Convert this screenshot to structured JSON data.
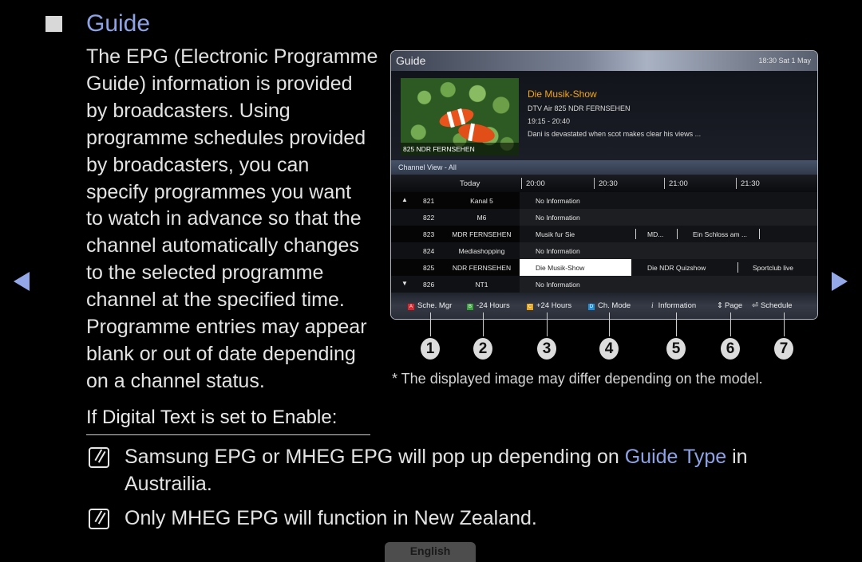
{
  "heading": {
    "title": "Guide"
  },
  "body_lines": [
    "The EPG (Electronic Programme",
    "Guide) information is provided",
    "by broadcasters. Using",
    "programme schedules provided",
    "by broadcasters, you can",
    "specify programmes you want",
    "to watch in advance so that the",
    "channel automatically changes",
    "to the selected programme",
    "channel at the specified time.",
    "Programme entries may appear",
    "blank or out of date depending",
    "on a channel status."
  ],
  "guide_panel": {
    "title": "Guide",
    "datetime": "18:30 Sat 1 May",
    "preview": {
      "thumb_caption": "825 NDR FERNSEHEN",
      "program_title": "Die Musik-Show",
      "channel_line": "DTV Air 825 NDR FERNSEHEN",
      "time_range": "19:15 - 20:40",
      "description": "Dani is devastated when scot makes clear his views ..."
    },
    "channel_view": "Channel View - All",
    "timeline": {
      "day": "Today",
      "times": [
        "20:00",
        "20:30",
        "21:00",
        "21:30"
      ]
    },
    "rows": [
      {
        "arrow": "▲",
        "num": "821",
        "name": "Kanal 5",
        "programs": [
          "No Information"
        ]
      },
      {
        "arrow": "",
        "num": "822",
        "name": "M6",
        "programs": [
          "No Information"
        ]
      },
      {
        "arrow": "",
        "num": "823",
        "name": "MDR FERNSEHEN",
        "programs": [
          "Musik fur Sie",
          "MD...",
          "Ein Schloss am ..."
        ]
      },
      {
        "arrow": "",
        "num": "824",
        "name": "Mediashopping",
        "programs": [
          "No Information"
        ]
      },
      {
        "arrow": "",
        "num": "825",
        "name": "NDR FERNSEHEN",
        "programs": [
          "Die Musik-Show",
          "Die NDR Quizshow",
          "Sportclub live"
        ]
      },
      {
        "arrow": "▼",
        "num": "826",
        "name": "NT1",
        "programs": [
          "No Information"
        ]
      }
    ],
    "footer": [
      {
        "key": "A",
        "color": "#e0262b",
        "label": "Sche. Mgr"
      },
      {
        "key": "B",
        "color": "#3aa23a",
        "label": "-24 Hours"
      },
      {
        "key": "C",
        "color": "#e8a820",
        "label": "+24 Hours"
      },
      {
        "key": "D",
        "color": "#1e8fd8",
        "label": "Ch. Mode"
      },
      {
        "icon": "info-icon",
        "glyph": "i",
        "label": "Information"
      },
      {
        "icon": "page-updown-icon",
        "glyph": "⇕",
        "label": "Page"
      },
      {
        "icon": "enter-icon",
        "glyph": "⏎",
        "label": "Schedule"
      }
    ]
  },
  "callouts": [
    "1",
    "2",
    "3",
    "4",
    "5",
    "6",
    "7"
  ],
  "disclaimer": "* The displayed image may differ depending on the model.",
  "subheading": "If Digital Text is set to Enable:",
  "notes": [
    {
      "before": "Samsung EPG or MHEG EPG will pop up depending on ",
      "highlight": "Guide Type",
      "after": " in",
      "line2": "Austrailia."
    },
    {
      "before": "Only MHEG EPG will function in New Zealand.",
      "highlight": "",
      "after": "",
      "line2": ""
    }
  ],
  "language_button": "English",
  "nav": {
    "prev": "previous-page",
    "next": "next-page"
  },
  "colors": {
    "accent": "#8ea3e6",
    "program_title": "#f2a617"
  }
}
